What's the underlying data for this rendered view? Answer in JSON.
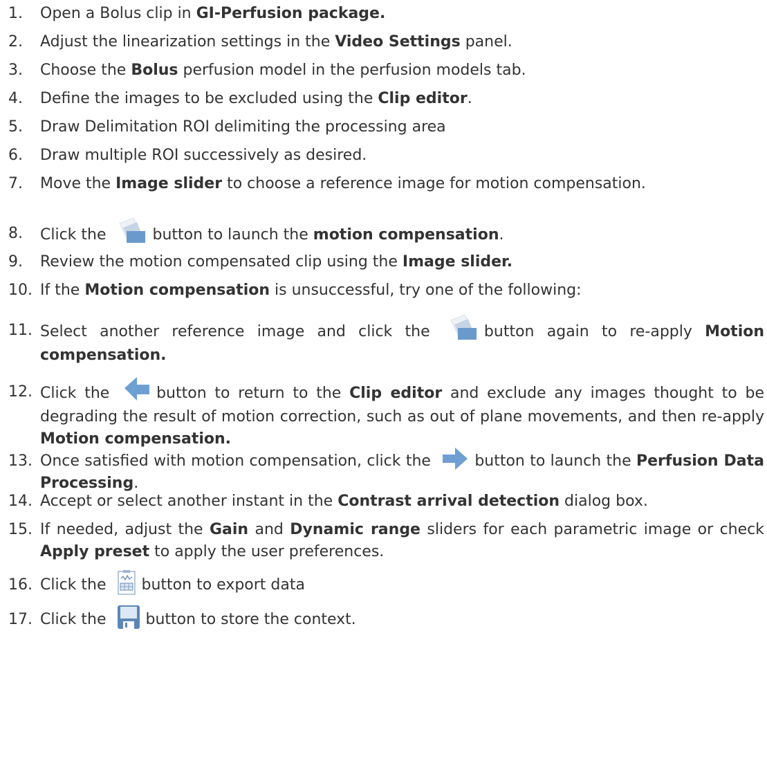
{
  "steps": [
    {
      "num": "1.",
      "parts": [
        {
          "t": "Open a Bolus clip in "
        },
        {
          "b": "GI-Perfusion package."
        }
      ]
    },
    {
      "num": "2.",
      "parts": [
        {
          "t": "Adjust the linearization settings in the "
        },
        {
          "b": "Video Settings"
        },
        {
          "t": " panel."
        }
      ]
    },
    {
      "num": "3.",
      "parts": [
        {
          "t": "Choose the "
        },
        {
          "b": "Bolus"
        },
        {
          "t": " perfusion model in the perfusion models tab."
        }
      ]
    },
    {
      "num": "4.",
      "parts": [
        {
          "t": "Define the images to be excluded using the "
        },
        {
          "b": "Clip editor"
        },
        {
          "t": "."
        }
      ]
    },
    {
      "num": "5.",
      "parts": [
        {
          "t": "Draw Delimitation ROI delimiting the processing area"
        }
      ]
    },
    {
      "num": "6.",
      "parts": [
        {
          "t": "Draw multiple ROI successively as desired."
        }
      ]
    },
    {
      "num": "7.",
      "parts": [
        {
          "t": "Move the "
        },
        {
          "b": "Image slider"
        },
        {
          "t": " to choose a reference image for motion compensation."
        }
      ]
    },
    {
      "num": "8.",
      "parts": [
        {
          "t": "Click the "
        },
        {
          "icon": "stacked-images-icon"
        },
        {
          "t": "button to launch the "
        },
        {
          "b": "motion compensation"
        },
        {
          "t": "."
        }
      ]
    },
    {
      "num": "9.",
      "parts": [
        {
          "t": "Review the motion compensated clip using the "
        },
        {
          "b": "Image slider."
        }
      ]
    },
    {
      "num": "10.",
      "parts": [
        {
          "t": "If the "
        },
        {
          "b": "Motion compensation"
        },
        {
          "t": " is unsuccessful, try one of the following:"
        }
      ]
    },
    {
      "num": "11.",
      "parts": [
        {
          "t": "Select another reference image and click the "
        },
        {
          "icon": "stacked-images-icon"
        },
        {
          "t": "button again to re-apply "
        },
        {
          "b": "Motion compensation."
        }
      ]
    },
    {
      "num": "12.",
      "parts": [
        {
          "t": "Click the "
        },
        {
          "icon": "arrow-left-icon"
        },
        {
          "t": "button to return to the "
        },
        {
          "b": "Clip editor"
        },
        {
          "t": " and exclude any images thought to be degrading the result of motion correction, such as out of plane movements, and then re-apply "
        },
        {
          "b": "Motion compensation."
        }
      ]
    },
    {
      "num": "13.",
      "parts": [
        {
          "t": "Once satisfied with motion compensation, click the "
        },
        {
          "icon": "arrow-right-icon"
        },
        {
          "t": "button to launch the "
        },
        {
          "b": "Perfusion Data Processing"
        },
        {
          "t": "."
        }
      ]
    },
    {
      "num": "14.",
      "parts": [
        {
          "t": "Accept or select another instant in the "
        },
        {
          "b": "Contrast arrival detection"
        },
        {
          "t": " dialog box."
        }
      ]
    },
    {
      "num": "15.",
      "parts": [
        {
          "t": "If needed, adjust the "
        },
        {
          "b": "Gain"
        },
        {
          "t": " and "
        },
        {
          "b": "Dynamic range"
        },
        {
          "t": " sliders for each parametric image or check "
        },
        {
          "b": "Apply preset"
        },
        {
          "t": " to apply the user preferences."
        }
      ]
    },
    {
      "num": "16.",
      "parts": [
        {
          "t": "Click the "
        },
        {
          "icon": "export-data-icon"
        },
        {
          "t": "button to export data"
        }
      ]
    },
    {
      "num": "17.",
      "parts": [
        {
          "t": "Click the "
        },
        {
          "icon": "save-disk-icon"
        },
        {
          "t": "button to store the context."
        }
      ]
    }
  ]
}
